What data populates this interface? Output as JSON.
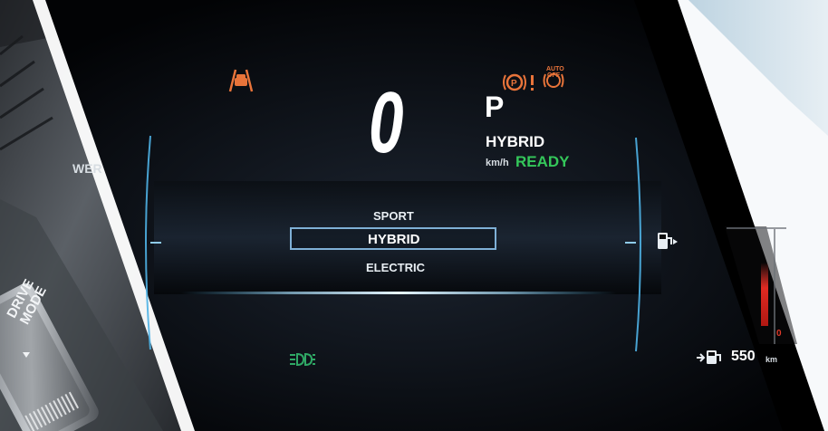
{
  "cluster": {
    "speed": "0",
    "speed_unit": "km/h",
    "gear": "P",
    "powertrain_status": "HYBRID",
    "ready_text": "READY",
    "power_gauge_label": "WER",
    "range_value": "550",
    "range_unit": "km",
    "gauge_zero": "0"
  },
  "drive_modes": {
    "items": [
      "SPORT",
      "HYBRID",
      "ELECTRIC"
    ],
    "selected": "HYBRID"
  },
  "console": {
    "drive_mode_button_label": "DRIVE\nMODE"
  },
  "indicators": {
    "auto_hold_label": "AUTO\nOFF"
  },
  "colors": {
    "warning_orange": "#e8743a",
    "ready_green": "#34c75a",
    "gauge_blue": "#4fb3e6",
    "selection_border": "#7fb0d6"
  },
  "icons": [
    "lane-assist-icon",
    "parking-brake-icon",
    "auto-hold-icon",
    "fuel-pump-icon",
    "headlight-icon",
    "range-fuel-icon",
    "chevron-down-icon"
  ]
}
